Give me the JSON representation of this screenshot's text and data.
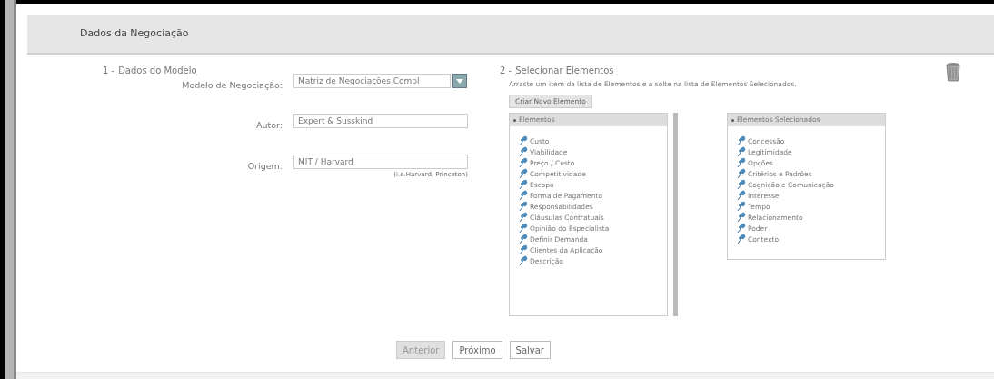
{
  "header": {
    "title": "Dados da Negociação"
  },
  "section1": {
    "number": "1 -",
    "title": "Dados do Modelo",
    "fields": [
      {
        "kind": "select",
        "label": "Modelo de Negociação:",
        "value": "Matriz de Negociações Compl"
      },
      {
        "kind": "text",
        "label": "Autor:",
        "value": "Expert & Susskind"
      },
      {
        "kind": "text",
        "label": "Origem:",
        "value": "MIT / Harvard",
        "hint": "(i.e.Harvard, Princeton)"
      }
    ]
  },
  "section2": {
    "number": "2 -",
    "title": "Selecionar Elementos",
    "instruction": "Arraste um item da lista de Elementos e a solte na lista de Elementos Selecionados.",
    "create_button": "Criar Novo Elemento",
    "lists": [
      {
        "title": "Elementos",
        "items": [
          "Custo",
          "Viabilidade",
          "Preço / Custo",
          "Competitividade",
          "Escopo",
          "Forma de Pagamento",
          "Responsabilidades",
          "Cláusulas Contratuais",
          "Opinião do Especialista",
          "Definir Demanda",
          "Clientes da Aplicação",
          "Descrição"
        ]
      },
      {
        "title": "Elementos Selecionados",
        "items": [
          "Concessão",
          "Legitimidade",
          "Opções",
          "Critérios e Padrões",
          "Cognição e Comunicação",
          "Interesse",
          "Tempo",
          "Relacionamento",
          "Poder",
          "Contexto"
        ]
      }
    ]
  },
  "buttons": [
    {
      "label": "Anterior",
      "disabled": true
    },
    {
      "label": "Próximo",
      "disabled": false
    },
    {
      "label": "Salvar",
      "disabled": false
    }
  ]
}
